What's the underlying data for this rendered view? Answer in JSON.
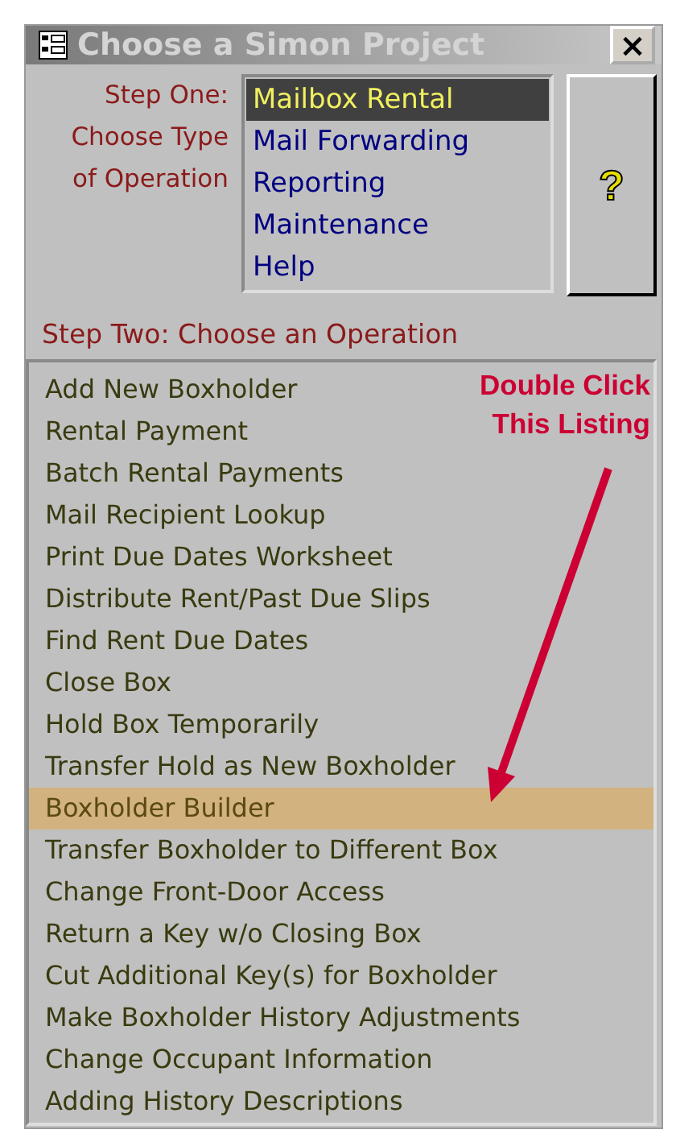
{
  "window": {
    "title": "Choose a Simon Project",
    "close": "×"
  },
  "step_one": {
    "label": "Step One: Choose Type of Operation",
    "options": [
      {
        "label": "Mailbox Rental",
        "selected": true
      },
      {
        "label": "Mail Forwarding",
        "selected": false
      },
      {
        "label": "Reporting",
        "selected": false
      },
      {
        "label": "Maintenance",
        "selected": false
      },
      {
        "label": "Help",
        "selected": false
      }
    ]
  },
  "help_button": {
    "label": "?"
  },
  "step_two": {
    "label": "Step Two: Choose an Operation",
    "operations": [
      {
        "label": "Add New Boxholder",
        "selected": false
      },
      {
        "label": "Rental Payment",
        "selected": false
      },
      {
        "label": "Batch Rental Payments",
        "selected": false
      },
      {
        "label": "Mail Recipient Lookup",
        "selected": false
      },
      {
        "label": "Print Due Dates Worksheet",
        "selected": false
      },
      {
        "label": "Distribute Rent/Past Due Slips",
        "selected": false
      },
      {
        "label": "Find Rent Due Dates",
        "selected": false
      },
      {
        "label": "Close Box",
        "selected": false
      },
      {
        "label": "Hold Box Temporarily",
        "selected": false
      },
      {
        "label": "Transfer Hold as New Boxholder",
        "selected": false
      },
      {
        "label": "Boxholder Builder",
        "selected": true
      },
      {
        "label": "Transfer Boxholder to Different Box",
        "selected": false
      },
      {
        "label": "Change Front-Door Access",
        "selected": false
      },
      {
        "label": "Return a Key w/o Closing Box",
        "selected": false
      },
      {
        "label": "Cut Additional Key(s) for Boxholder",
        "selected": false
      },
      {
        "label": "Make Boxholder History Adjustments",
        "selected": false
      },
      {
        "label": "Change Occupant Information",
        "selected": false
      },
      {
        "label": "Adding History Descriptions",
        "selected": false
      }
    ]
  },
  "annotation": {
    "lines": [
      "Double Click",
      "This Listing"
    ]
  }
}
